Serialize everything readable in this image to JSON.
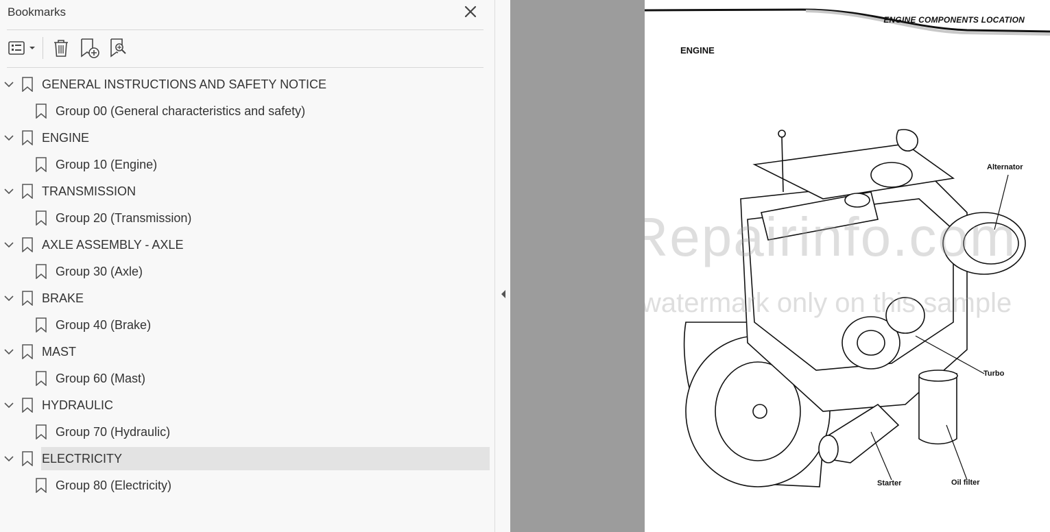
{
  "panel": {
    "title": "Bookmarks",
    "toolbar": {
      "options_icon": "list-options-icon",
      "delete_icon": "trash-icon",
      "add_icon": "add-bookmark-icon",
      "find_icon": "find-bookmark-icon"
    }
  },
  "bookmarks": [
    {
      "label": "GENERAL INSTRUCTIONS AND SAFETY NOTICE",
      "child": "Group 00 (General characteristics and safety)"
    },
    {
      "label": "ENGINE",
      "child": "Group 10 (Engine)"
    },
    {
      "label": "TRANSMISSION",
      "child": "Group 20 (Transmission)"
    },
    {
      "label": "AXLE ASSEMBLY - AXLE",
      "child": "Group 30 (Axle)"
    },
    {
      "label": "BRAKE",
      "child": "Group 40 (Brake)"
    },
    {
      "label": "MAST",
      "child": "Group 60 (Mast)"
    },
    {
      "label": "HYDRAULIC",
      "child": "Group 70 (Hydraulic)"
    },
    {
      "label": "ELECTRICITY",
      "child": "Group 80 (Electricity)",
      "selected": true
    }
  ],
  "document": {
    "header": "ENGINE COMPONENTS LOCATION",
    "section": "ENGINE",
    "callouts": {
      "alternator": "Alternator",
      "turbo": "Turbo",
      "starter": "Starter",
      "oil_filter": "Oil filter"
    },
    "watermark_main": "eRepairinfo.com",
    "watermark_sub": "watermark only on this sample"
  }
}
